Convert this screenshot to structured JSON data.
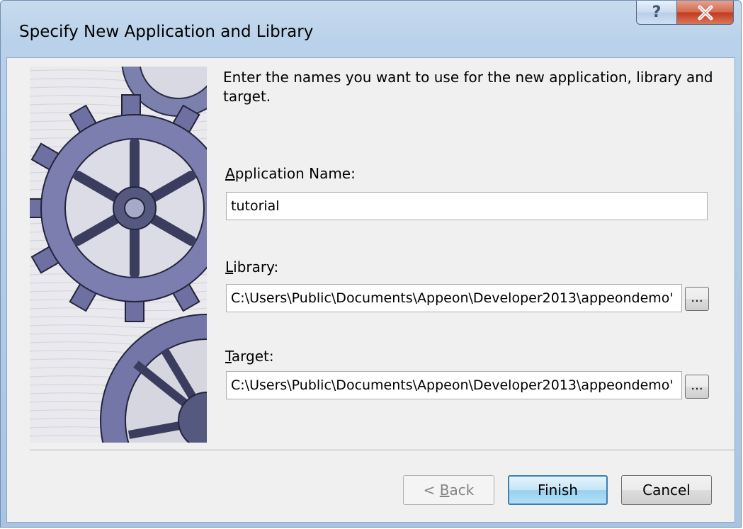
{
  "window": {
    "title": "Specify New Application and Library",
    "help_glyph": "?",
    "close_icon": "close-icon"
  },
  "instructions": "Enter the names you want to use for the new application, library and target.",
  "fields": {
    "application": {
      "label_prefix": "",
      "label_accel": "A",
      "label_rest": "pplication Name:",
      "value": "tutorial"
    },
    "library": {
      "label_prefix": "",
      "label_accel": "L",
      "label_rest": "ibrary:",
      "value": "C:\\Users\\Public\\Documents\\Appeon\\Developer2013\\appeondemo'",
      "browse_label": "..."
    },
    "target": {
      "label_prefix": "",
      "label_accel": "T",
      "label_rest": "arget:",
      "value": "C:\\Users\\Public\\Documents\\Appeon\\Developer2013\\appeondemo'",
      "browse_label": "..."
    }
  },
  "buttons": {
    "back_prefix": "< ",
    "back_accel": "B",
    "back_rest": "ack",
    "finish": "Finish",
    "cancel": "Cancel"
  },
  "colors": {
    "titlebar": "#b9d1ea",
    "client": "#f0f0f0",
    "close_button": "#c23a1f",
    "gear": "#5b5f8c"
  }
}
